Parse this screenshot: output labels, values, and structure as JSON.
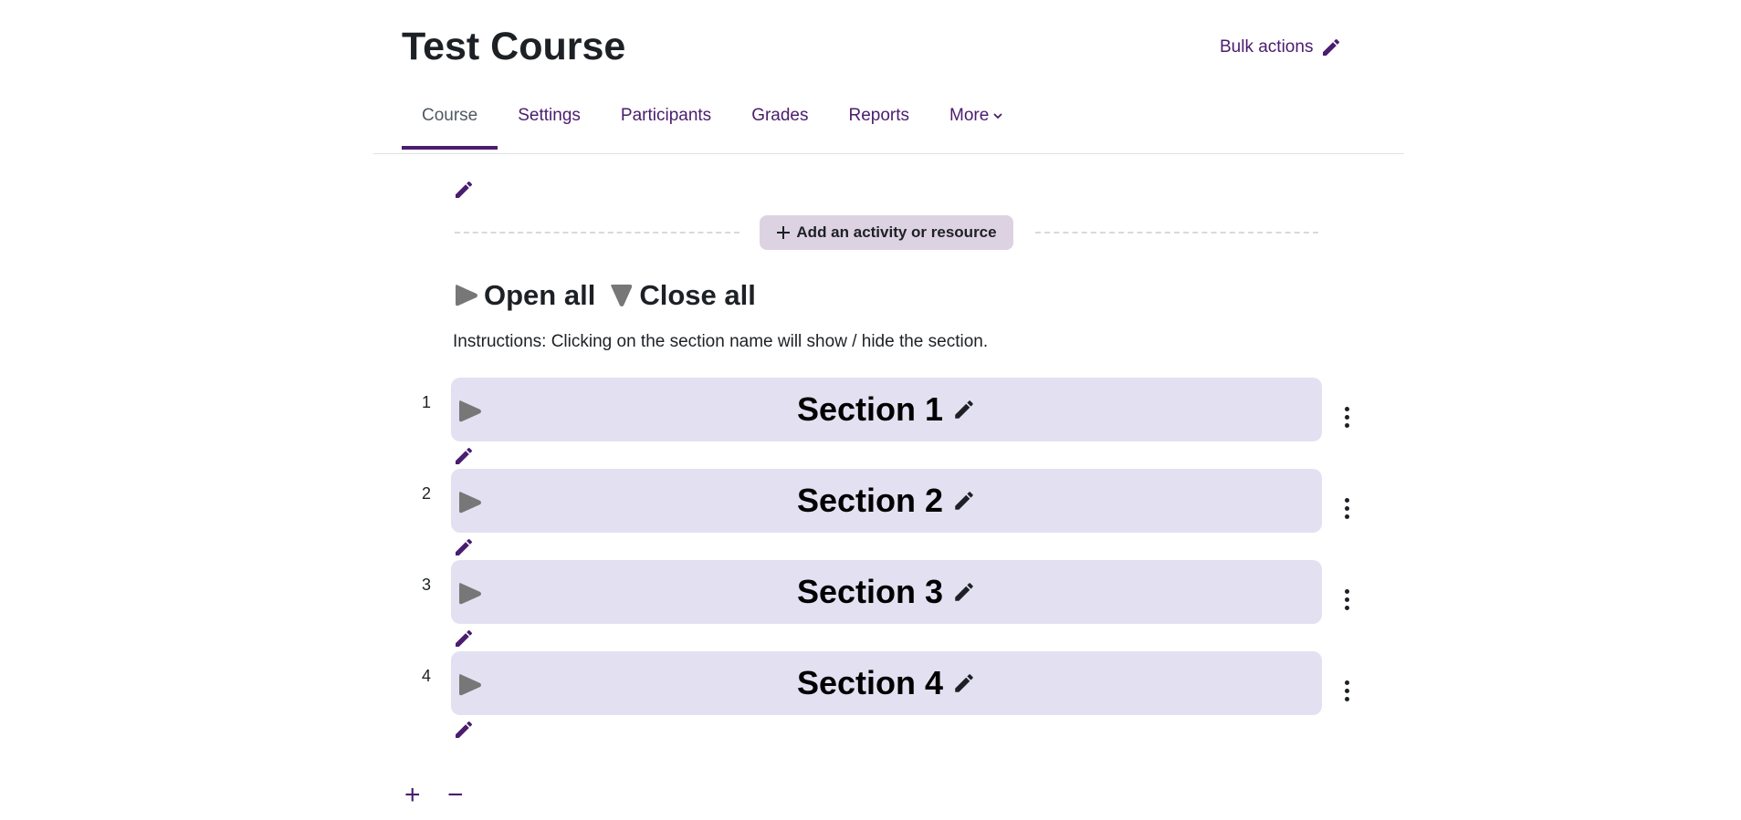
{
  "course": {
    "title": "Test Course"
  },
  "header": {
    "bulk_actions_label": "Bulk actions",
    "bulk_icon": "pencil-icon"
  },
  "nav": {
    "tabs": [
      {
        "label": "Course",
        "active": true
      },
      {
        "label": "Settings"
      },
      {
        "label": "Participants"
      },
      {
        "label": "Grades"
      },
      {
        "label": "Reports"
      },
      {
        "label": "More",
        "icon": "chevron-down-icon"
      }
    ]
  },
  "add_activity": {
    "label": "Add an activity or resource",
    "icon": "plus-icon"
  },
  "toggle_all": {
    "open_label": "Open all",
    "close_label": "Close all"
  },
  "instructions": "Instructions: Clicking on the section name will show / hide the section.",
  "sections": [
    {
      "number": "1",
      "name": "Section 1"
    },
    {
      "number": "2",
      "name": "Section 2"
    },
    {
      "number": "3",
      "name": "Section 3"
    },
    {
      "number": "4",
      "name": "Section 4"
    }
  ],
  "footer": {
    "add_symbol": "+",
    "remove_symbol": "−"
  },
  "colors": {
    "accent": "#4a1d6e",
    "section_bg": "#e3e1f1",
    "button_bg": "#ddd2e2",
    "arrow_gray": "#777777"
  }
}
